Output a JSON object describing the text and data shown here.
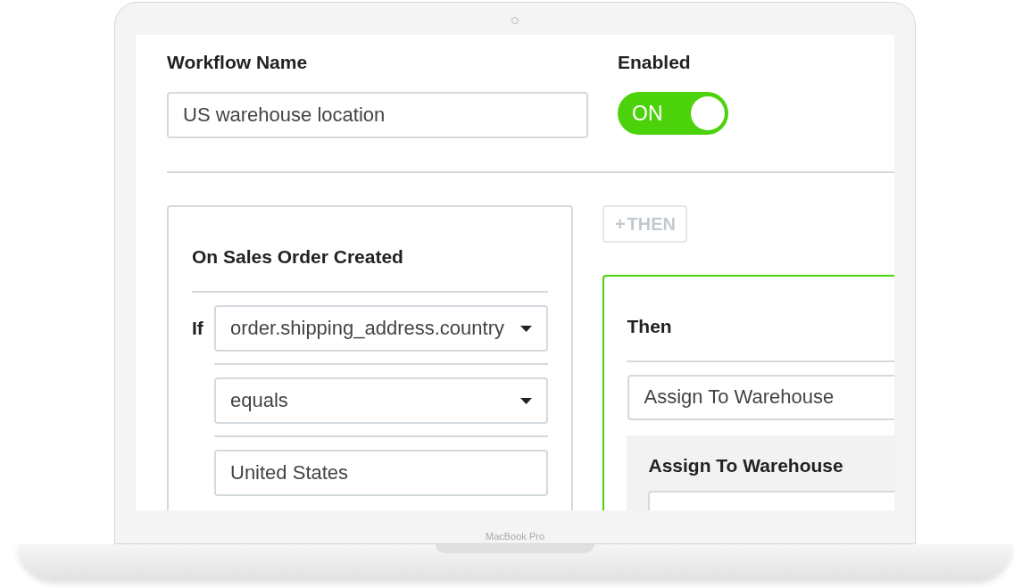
{
  "workflow_name": {
    "label": "Workflow Name",
    "value": "US warehouse location"
  },
  "enabled": {
    "label": "Enabled",
    "on": true,
    "text": "ON"
  },
  "add_then_button": {
    "icon": "+",
    "label": "THEN"
  },
  "trigger": {
    "title": "On Sales Order Created",
    "if_label": "If",
    "fields": [
      {
        "kind": "select",
        "value": "order.shipping_address.country"
      },
      {
        "kind": "select",
        "value": "equals"
      },
      {
        "kind": "input",
        "value": "United States"
      }
    ]
  },
  "action": {
    "title": "Then",
    "value": "Assign To Warehouse",
    "panel_title": "Assign To Warehouse"
  },
  "device_label": "MacBook Pro"
}
